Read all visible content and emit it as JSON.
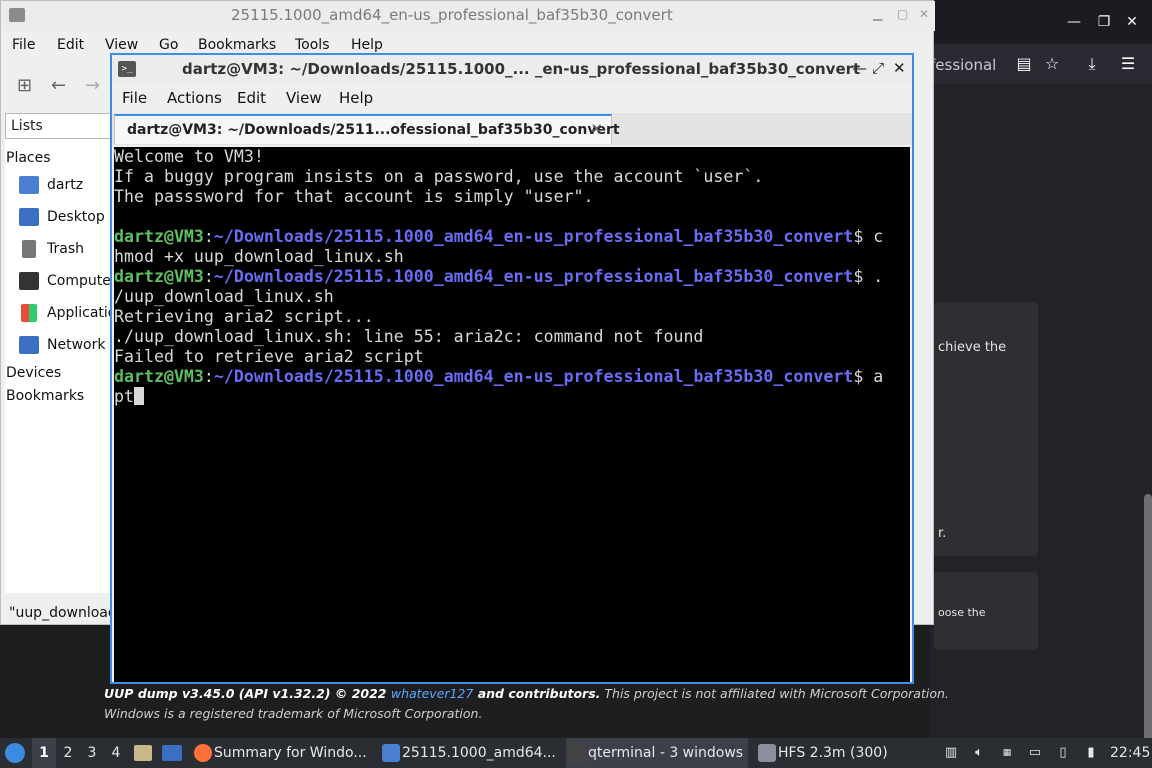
{
  "browser": {
    "url_fragment": "fessional",
    "card_texts": [
      "chieve the",
      "r.",
      "oose the"
    ]
  },
  "footer": {
    "brand": "UUP dump",
    "version": " v3.45.0 (",
    "api": "API",
    "api_version": " v1.32.2) © 2022 ",
    "author": "whatever127",
    "contributors": " and contributors.",
    "disclaimer": " This project is not affiliated with Microsoft Corporation. Windows is a registered trademark of Microsoft Corporation."
  },
  "file_manager": {
    "title": "25115.1000_amd64_en-us_professional_baf35b30_convert",
    "menu": [
      "File",
      "Edit",
      "View",
      "Go",
      "Bookmarks",
      "Tools",
      "Help"
    ],
    "sidebar_combo": "Lists",
    "places_label": "Places",
    "places": [
      "dartz",
      "Desktop",
      "Trash",
      "Computer",
      "Applications",
      "Network"
    ],
    "devices_label": "Devices",
    "bookmarks_label": "Bookmarks",
    "status": "\"uup_download"
  },
  "terminal": {
    "title": "dartz@VM3: ~/Downloads/25115.1000_... _en-us_professional_baf35b30_convert",
    "menu": [
      "File",
      "Actions",
      "Edit",
      "View",
      "Help"
    ],
    "tab_label": "dartz@VM3: ~/Downloads/2511...ofessional_baf35b30_convert",
    "motd": [
      "Welcome to VM3!",
      "If a buggy program insists on a password, use the account `user`.",
      "The passsword for that account is simply \"user\"."
    ],
    "prompt_user": "dartz@VM3",
    "prompt_path": "~/Downloads/25115.1000_amd64_en-us_professional_baf35b30_convert",
    "cmd1_a": " c",
    "cmd1_b": "hmod +x uup_download_linux.sh",
    "cmd2_a": " .",
    "cmd2_b": "/uup_download_linux.sh",
    "out1": "Retrieving aria2 script...",
    "out2": "./uup_download_linux.sh: line 55: aria2c: command not found",
    "out3": "Failed to retrieve aria2 script",
    "cmd3_a": " a",
    "cmd3_b": "pt"
  },
  "taskbar": {
    "workspaces": [
      "1",
      "2",
      "3",
      "4"
    ],
    "tasks": [
      "Summary for Windo...",
      "25115.1000_amd64...",
      "qterminal - 3 windows",
      "HFS 2.3m (300)"
    ],
    "clock": "22:45"
  }
}
